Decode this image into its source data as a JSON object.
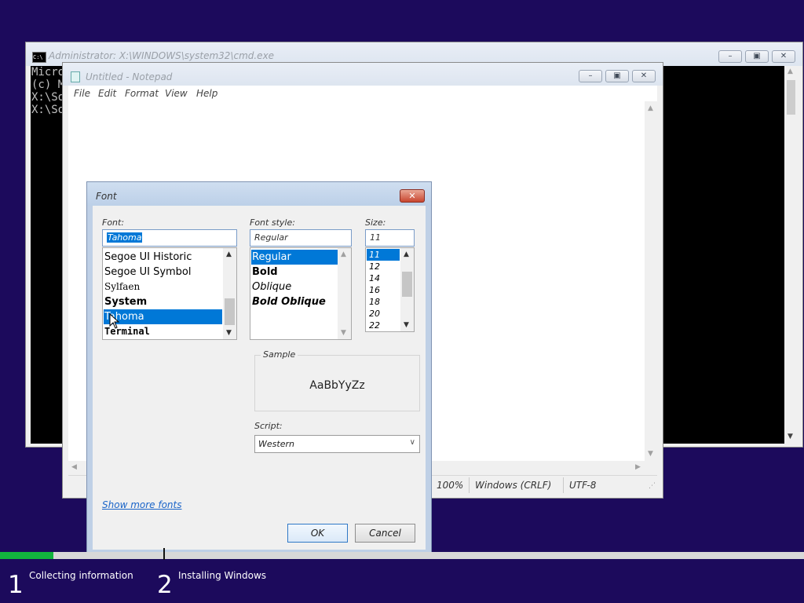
{
  "cmd": {
    "title": "Administrator: X:\\WINDOWS\\system32\\cmd.exe",
    "lines": [
      "Micro",
      "(c) M",
      "",
      "X:\\So",
      "",
      "X:\\So"
    ]
  },
  "notepad": {
    "title": "Untitled - Notepad",
    "menu": [
      "File",
      "Edit",
      "Format",
      "View",
      "Help"
    ],
    "status": {
      "zoom": "100%",
      "line_ending": "Windows (CRLF)",
      "encoding": "UTF-8"
    }
  },
  "font_dialog": {
    "title": "Font",
    "font_label": "Font:",
    "font_value": "Tahoma",
    "font_list": [
      "Segoe UI Historic",
      "Segoe UI Symbol",
      "Sylfaen",
      "System",
      "Tahoma",
      "Terminal"
    ],
    "font_selected": "Tahoma",
    "style_label": "Font style:",
    "style_value": "Regular",
    "style_list": [
      "Regular",
      "Bold",
      "Oblique",
      "Bold Oblique"
    ],
    "style_selected": "Regular",
    "size_label": "Size:",
    "size_value": "11",
    "size_list": [
      "11",
      "12",
      "14",
      "16",
      "18",
      "20",
      "22"
    ],
    "size_selected": "11",
    "sample_label": "Sample",
    "sample_text": "AaBbYyZz",
    "script_label": "Script:",
    "script_value": "Western",
    "show_more_fonts": "Show more fonts",
    "ok_label": "OK",
    "cancel_label": "Cancel"
  },
  "setup": {
    "progress_fraction": 0.066,
    "steps": [
      {
        "number": "1",
        "label": "Collecting information"
      },
      {
        "number": "2",
        "label": "Installing Windows"
      }
    ]
  },
  "colors": {
    "background": "#1c0a5c",
    "selection": "#0078d7",
    "progress": "#12b43e"
  }
}
